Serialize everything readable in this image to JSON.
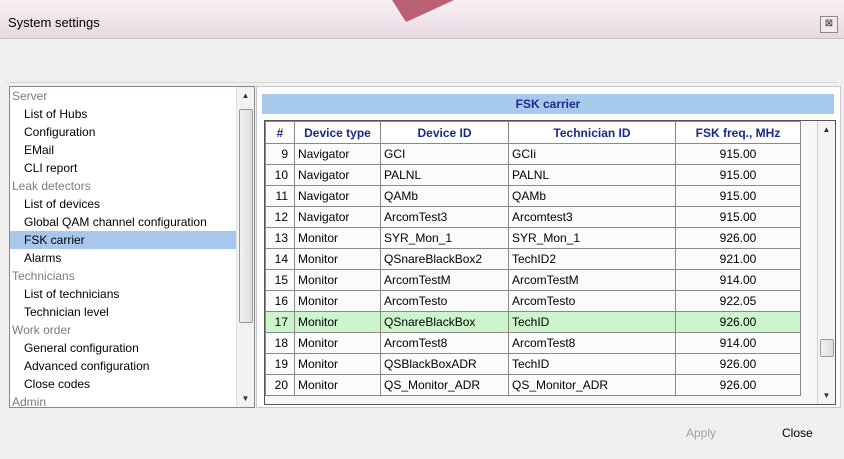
{
  "window": {
    "title": "System settings",
    "close_glyph": "⊠"
  },
  "tree": {
    "rows": [
      {
        "label": "Server",
        "type": "group"
      },
      {
        "label": "List of Hubs",
        "type": "item"
      },
      {
        "label": "Configuration",
        "type": "item"
      },
      {
        "label": "EMail",
        "type": "item"
      },
      {
        "label": "CLI report",
        "type": "item"
      },
      {
        "label": "Leak detectors",
        "type": "group"
      },
      {
        "label": "List of devices",
        "type": "item"
      },
      {
        "label": "Global QAM channel configuration",
        "type": "item"
      },
      {
        "label": "FSK carrier",
        "type": "item",
        "selected": true
      },
      {
        "label": "Alarms",
        "type": "item"
      },
      {
        "label": "Technicians",
        "type": "group"
      },
      {
        "label": "List of technicians",
        "type": "item"
      },
      {
        "label": "Technician level",
        "type": "item"
      },
      {
        "label": "Work order",
        "type": "group"
      },
      {
        "label": "General configuration",
        "type": "item"
      },
      {
        "label": "Advanced configuration",
        "type": "item"
      },
      {
        "label": "Close codes",
        "type": "item"
      },
      {
        "label": "Admin",
        "type": "group"
      }
    ]
  },
  "panel": {
    "caption": "FSK carrier"
  },
  "table": {
    "columns": [
      "#",
      "Device type",
      "Device ID",
      "Technician ID",
      "FSK freq., MHz"
    ],
    "rows": [
      [
        "9",
        "Navigator",
        "GCI",
        "GCIi",
        "915.00"
      ],
      [
        "10",
        "Navigator",
        "PALNL",
        "PALNL",
        "915.00"
      ],
      [
        "11",
        "Navigator",
        "QAMb",
        "QAMb",
        "915.00"
      ],
      [
        "12",
        "Navigator",
        "ArcomTest3",
        "Arcomtest3",
        "915.00"
      ],
      [
        "13",
        "Monitor",
        "SYR_Mon_1",
        "SYR_Mon_1",
        "926.00"
      ],
      [
        "14",
        "Monitor",
        "QSnareBlackBox2",
        "TechID2",
        "921.00"
      ],
      [
        "15",
        "Monitor",
        "ArcomTestM",
        "ArcomTestM",
        "914.00"
      ],
      [
        "16",
        "Monitor",
        "ArcomTesto",
        "ArcomTesto",
        "922.05"
      ],
      [
        "17",
        "Monitor",
        "QSnareBlackBox",
        "TechID",
        "926.00"
      ],
      [
        "18",
        "Monitor",
        "ArcomTest8",
        "ArcomTest8",
        "914.00"
      ],
      [
        "19",
        "Monitor",
        "QSBlackBoxADR",
        "TechID",
        "926.00"
      ],
      [
        "20",
        "Monitor",
        "QS_Monitor_ADR",
        "QS_Monitor_ADR",
        "926.00"
      ]
    ],
    "highlighted_row_index": 8
  },
  "footer": {
    "apply_label": "Apply",
    "close_label": "Close"
  },
  "colors": {
    "caption_bg": "#a6c9ec",
    "header_text": "#1a2a8a",
    "selected_bg": "#a7c8ec",
    "highlight_row": "#ccf5cc"
  }
}
